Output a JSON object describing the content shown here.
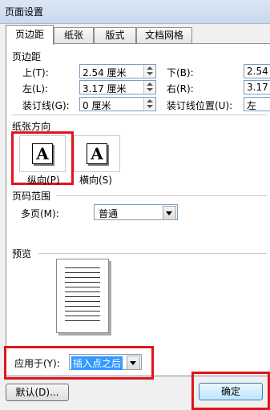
{
  "window": {
    "title": "页面设置"
  },
  "tabs": [
    {
      "label": "页边距",
      "active": true
    },
    {
      "label": "纸张",
      "active": false
    },
    {
      "label": "版式",
      "active": false
    },
    {
      "label": "文档网格",
      "active": false
    }
  ],
  "margins": {
    "section_title": "页边距",
    "top": {
      "label": "上(T):",
      "value": "2.54 厘米"
    },
    "bottom": {
      "label": "下(B):",
      "value": "2.54"
    },
    "left": {
      "label": "左(L):",
      "value": "3.17 厘米"
    },
    "right": {
      "label": "右(R):",
      "value": "3.17"
    },
    "gutter": {
      "label": "装订线(G):",
      "value": "0 厘米"
    },
    "gutter_position": {
      "label": "装订线位置(U):",
      "value": "左"
    }
  },
  "orientation": {
    "section_title": "纸张方向",
    "portrait": {
      "label": "纵向(P)",
      "glyph": "A",
      "selected": true
    },
    "landscape": {
      "label": "横向(S)",
      "glyph": "A",
      "selected": false
    }
  },
  "pages": {
    "section_title": "页码范围",
    "multiple_label": "多页(M):",
    "multiple_value": "普通"
  },
  "preview": {
    "section_title": "预览"
  },
  "apply": {
    "label": "应用于(Y):",
    "value": "插入点之后"
  },
  "buttons": {
    "default": "默认(D)...",
    "ok": "确定"
  },
  "highlight_color": "#e0141e"
}
